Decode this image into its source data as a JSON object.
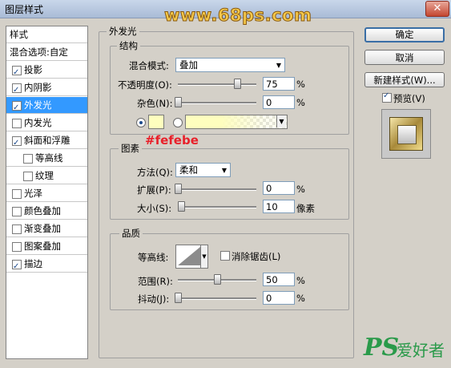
{
  "window": {
    "title": "图层样式",
    "close_glyph": "✕"
  },
  "watermark": "www.68ps.com",
  "sidebar": {
    "header": "样式",
    "blend_options": "混合选项:自定",
    "items": [
      {
        "label": "投影",
        "checked": true
      },
      {
        "label": "内阴影",
        "checked": true
      },
      {
        "label": "外发光",
        "checked": true,
        "selected": true
      },
      {
        "label": "内发光",
        "checked": false
      },
      {
        "label": "斜面和浮雕",
        "checked": true
      },
      {
        "label": "等高线",
        "checked": false,
        "indent": true
      },
      {
        "label": "纹理",
        "checked": false,
        "indent": true
      },
      {
        "label": "光泽",
        "checked": false
      },
      {
        "label": "颜色叠加",
        "checked": false
      },
      {
        "label": "渐变叠加",
        "checked": false
      },
      {
        "label": "图案叠加",
        "checked": false
      },
      {
        "label": "描边",
        "checked": true
      }
    ]
  },
  "panel": {
    "title": "外发光",
    "structure": {
      "legend": "结构",
      "blend_mode_label": "混合模式:",
      "blend_mode_value": "叠加",
      "opacity_label": "不透明度(O):",
      "opacity_value": "75",
      "opacity_unit": "%",
      "opacity_fraction": 0.75,
      "noise_label": "杂色(N):",
      "noise_value": "0",
      "noise_unit": "%",
      "noise_fraction": 0.0,
      "color_swatch": "#fefebe"
    },
    "annotation": "#fefebe",
    "elements": {
      "legend": "图素",
      "technique_label": "方法(Q):",
      "technique_value": "柔和",
      "spread_label": "扩展(P):",
      "spread_value": "0",
      "spread_unit": "%",
      "spread_fraction": 0.0,
      "size_label": "大小(S):",
      "size_value": "10",
      "size_unit": "像素",
      "size_fraction": 0.04
    },
    "quality": {
      "legend": "品质",
      "contour_label": "等高线:",
      "antialias_label": "消除锯齿(L)",
      "antialias_checked": false,
      "range_label": "范围(R):",
      "range_value": "50",
      "range_unit": "%",
      "range_fraction": 0.5,
      "jitter_label": "抖动(J):",
      "jitter_value": "0",
      "jitter_unit": "%",
      "jitter_fraction": 0.0
    }
  },
  "buttons": {
    "ok": "确定",
    "cancel": "取消",
    "new_style": "新建样式(W)...",
    "preview_label": "预览(V)",
    "preview_checked": true
  },
  "logo": {
    "ps": "PS",
    "site": "爱好者"
  }
}
